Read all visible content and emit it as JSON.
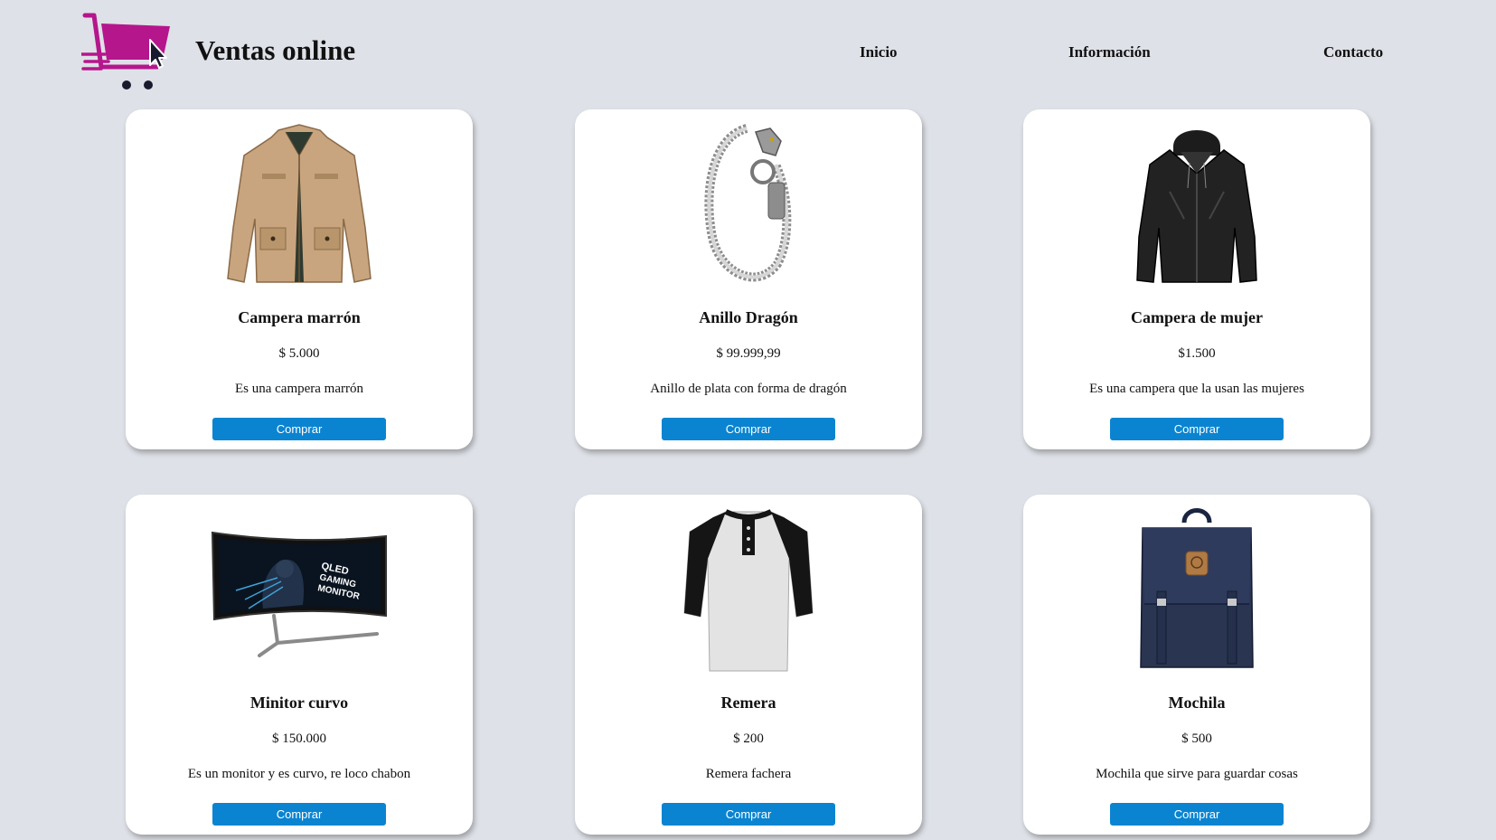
{
  "header": {
    "brand": "Ventas online",
    "logo_icon": "shopping-cart-cursor-icon",
    "brand_color": "#b5168c",
    "nav": [
      {
        "label": "Inicio"
      },
      {
        "label": "Información"
      },
      {
        "label": "Contacto"
      }
    ]
  },
  "theme": {
    "background": "#dee1e7",
    "card_background": "#ffffff",
    "button_color": "#0a84d0"
  },
  "products": [
    {
      "title": "Campera marrón",
      "price": "$ 5.000",
      "description": "Es una campera marrón",
      "button": "Comprar",
      "image": "brown-jacket-image"
    },
    {
      "title": "Anillo Dragón",
      "price": "$ 99.999,99",
      "description": "Anillo de plata con forma de dragón",
      "button": "Comprar",
      "image": "dragon-bracelet-image"
    },
    {
      "title": "Campera de mujer",
      "price": "$1.500",
      "description": "Es una campera que la usan las mujeres",
      "button": "Comprar",
      "image": "black-leather-jacket-image"
    },
    {
      "title": "Minitor curvo",
      "price": "$ 150.000",
      "description": "Es un monitor y es curvo, re loco chabon",
      "button": "Comprar",
      "image": "curved-monitor-image"
    },
    {
      "title": "Remera",
      "price": "$ 200",
      "description": "Remera fachera",
      "button": "Comprar",
      "image": "raglan-shirt-image"
    },
    {
      "title": "Mochila",
      "price": "$ 500",
      "description": "Mochila que sirve para guardar cosas",
      "button": "Comprar",
      "image": "navy-backpack-image"
    }
  ],
  "monitor_screen_text": [
    "QLED",
    "GAMING",
    "MONITOR"
  ]
}
